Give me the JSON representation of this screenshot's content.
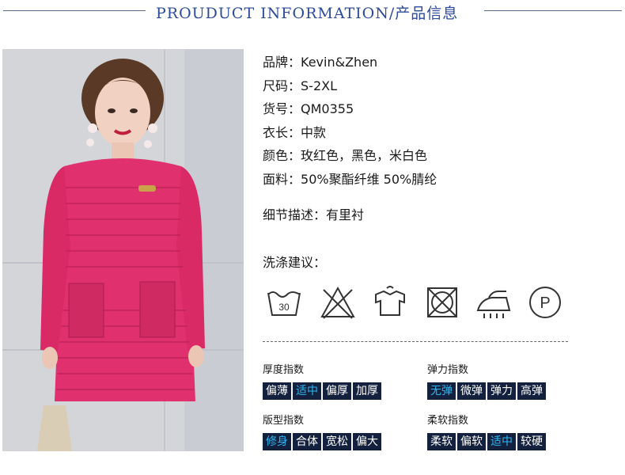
{
  "header": {
    "title": "PROUDUCT INFORMATION/产品信息"
  },
  "info": [
    {
      "label": "品牌：",
      "value": "Kevin&Zhen"
    },
    {
      "label": "尺码：",
      "value": "S-2XL"
    },
    {
      "label": "货号：",
      "value": "QM0355"
    },
    {
      "label": "衣长：",
      "value": "中款"
    },
    {
      "label": "颜色：",
      "value": "玫红色，黑色，米白色"
    },
    {
      "label": "面料：",
      "value": "50%聚酯纤维 50%腈纶"
    }
  ],
  "detail": {
    "label": "细节描述：",
    "value": "有里衬"
  },
  "wash": {
    "label": "洗涤建议：",
    "icons": [
      "wash-30-icon",
      "no-bleach-icon",
      "hang-dry-icon",
      "no-tumble-dry-icon",
      "iron-icon",
      "dry-clean-p-icon"
    ],
    "wash_temp": "30",
    "dryclean_letter": "P"
  },
  "indices": {
    "thickness": {
      "label": "厚度指数",
      "options": [
        "偏薄",
        "适中",
        "偏厚",
        "加厚"
      ],
      "selected": "适中"
    },
    "elasticity": {
      "label": "弹力指数",
      "options": [
        "无弹",
        "微弹",
        "弹力",
        "高弹"
      ],
      "selected": "无弹"
    },
    "fit": {
      "label": "版型指数",
      "options": [
        "修身",
        "合体",
        "宽松",
        "偏大"
      ],
      "selected": "修身"
    },
    "softness": {
      "label": "柔软指数",
      "options": [
        "柔软",
        "偏软",
        "适中",
        "较硬"
      ],
      "selected": "适中"
    }
  },
  "colors": {
    "option_bg": "#13213f",
    "selected_text": "#2fb6f0",
    "dress": "#e0306e",
    "title": "#2b4a9a"
  }
}
